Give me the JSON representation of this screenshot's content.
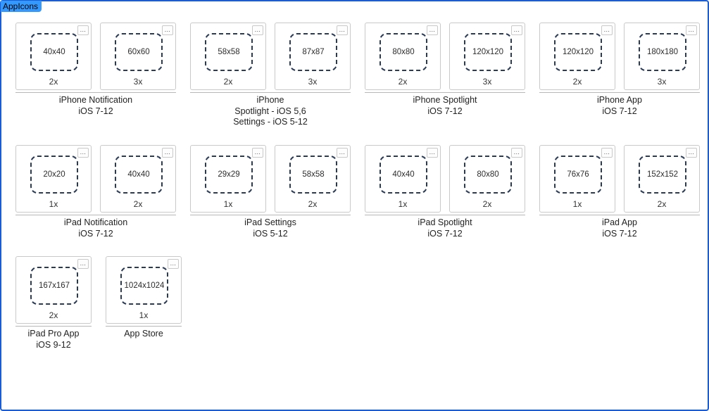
{
  "panel": {
    "title": "AppIcons"
  },
  "menu_glyph": "…",
  "rows": [
    [
      {
        "title": "iPhone Notification\niOS 7-12",
        "slots": [
          {
            "size": "40x40",
            "scale": "2x"
          },
          {
            "size": "60x60",
            "scale": "3x"
          }
        ]
      },
      {
        "title": "iPhone\nSpotlight - iOS 5,6\nSettings - iOS 5-12",
        "slots": [
          {
            "size": "58x58",
            "scale": "2x"
          },
          {
            "size": "87x87",
            "scale": "3x"
          }
        ]
      },
      {
        "title": "iPhone Spotlight\niOS 7-12",
        "slots": [
          {
            "size": "80x80",
            "scale": "2x"
          },
          {
            "size": "120x120",
            "scale": "3x"
          }
        ]
      },
      {
        "title": "iPhone App\niOS 7-12",
        "slots": [
          {
            "size": "120x120",
            "scale": "2x"
          },
          {
            "size": "180x180",
            "scale": "3x"
          }
        ]
      }
    ],
    [
      {
        "title": "iPad Notification\niOS 7-12",
        "slots": [
          {
            "size": "20x20",
            "scale": "1x"
          },
          {
            "size": "40x40",
            "scale": "2x"
          }
        ]
      },
      {
        "title": "iPad Settings\niOS 5-12",
        "slots": [
          {
            "size": "29x29",
            "scale": "1x"
          },
          {
            "size": "58x58",
            "scale": "2x"
          }
        ]
      },
      {
        "title": "iPad Spotlight\niOS 7-12",
        "slots": [
          {
            "size": "40x40",
            "scale": "1x"
          },
          {
            "size": "80x80",
            "scale": "2x"
          }
        ]
      },
      {
        "title": "iPad App\niOS 7-12",
        "slots": [
          {
            "size": "76x76",
            "scale": "1x"
          },
          {
            "size": "152x152",
            "scale": "2x"
          }
        ]
      }
    ],
    [
      {
        "title": "iPad Pro App\niOS 9-12",
        "slots": [
          {
            "size": "167x167",
            "scale": "2x"
          }
        ]
      },
      {
        "title": "App Store",
        "slots": [
          {
            "size": "1024x1024",
            "scale": "1x"
          }
        ]
      }
    ]
  ]
}
